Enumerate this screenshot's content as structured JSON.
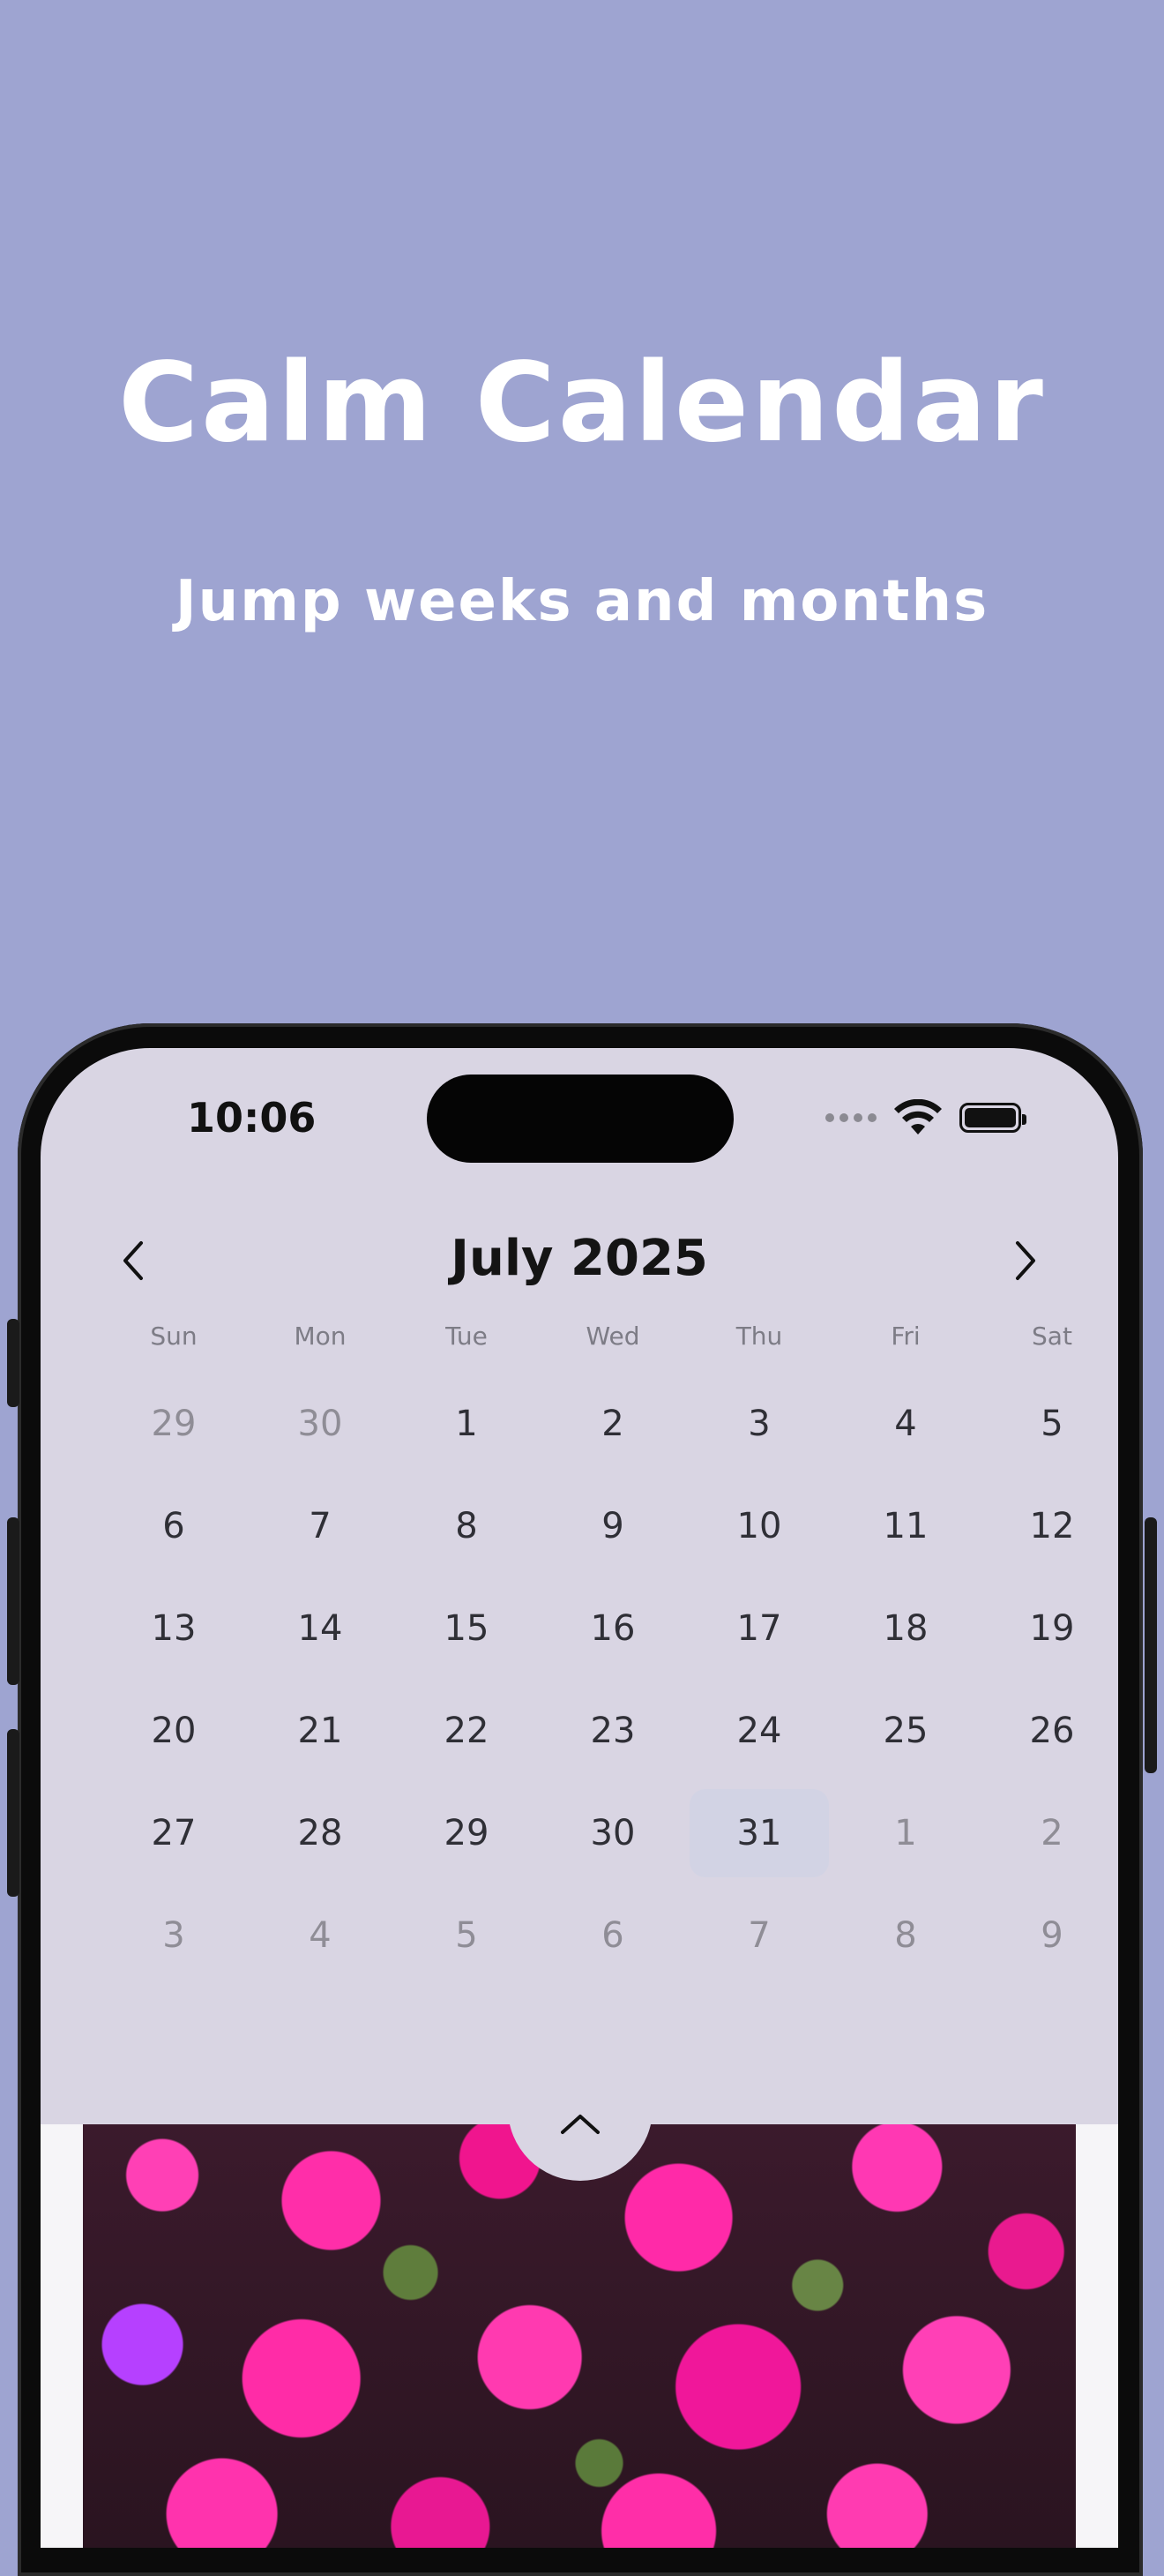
{
  "hero": {
    "title": "Calm Calendar",
    "subtitle": "Jump weeks and months"
  },
  "status_bar": {
    "time": "10:06",
    "icons": [
      "signal-dots-icon",
      "wifi-icon",
      "battery-icon"
    ]
  },
  "calendar": {
    "month_title": "July 2025",
    "prev_icon": "chevron-left-icon",
    "next_icon": "chevron-right-icon",
    "weekdays": [
      "Sun",
      "Mon",
      "Tue",
      "Wed",
      "Thu",
      "Fri",
      "Sat"
    ],
    "weeks": [
      [
        "29",
        "30",
        "1",
        "2",
        "3",
        "4",
        "5"
      ],
      [
        "6",
        "7",
        "8",
        "9",
        "10",
        "11",
        "12"
      ],
      [
        "13",
        "14",
        "15",
        "16",
        "17",
        "18",
        "19"
      ],
      [
        "20",
        "21",
        "22",
        "23",
        "24",
        "25",
        "26"
      ],
      [
        "27",
        "28",
        "29",
        "30",
        "31",
        "1",
        "2"
      ],
      [
        "3",
        "4",
        "5",
        "6",
        "7",
        "8",
        "9"
      ]
    ],
    "selected_day": "31"
  },
  "sheet": {
    "handle_icon": "chevron-up-icon",
    "photo": "magenta flowers photo"
  },
  "colors": {
    "background": "#9ea4d1",
    "screen": "#d9d5e3",
    "text": "#2f2f36",
    "muted_text": "#8f8d96",
    "highlight": "#d2d3e4"
  }
}
